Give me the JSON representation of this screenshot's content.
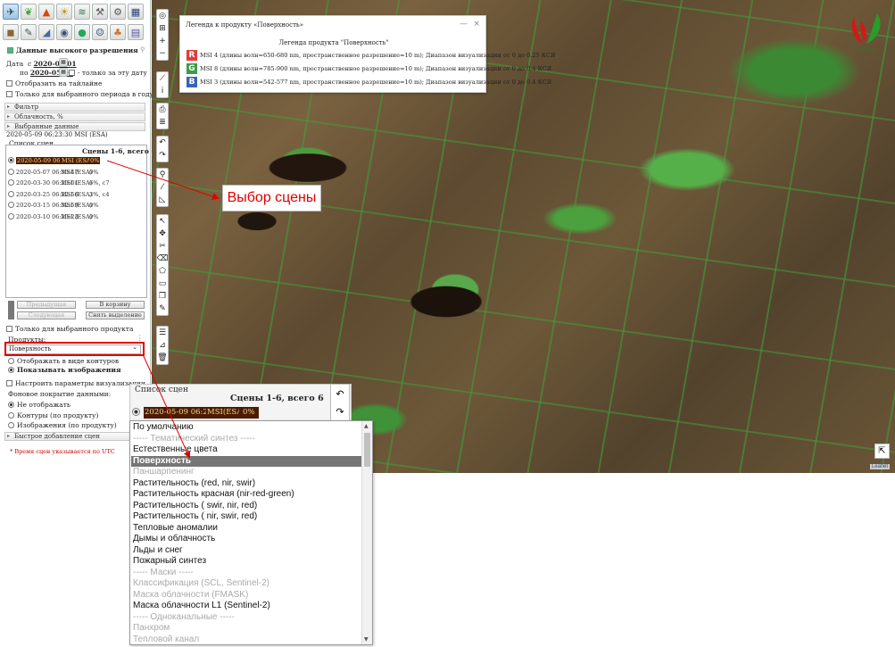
{
  "left": {
    "high_res_title": "Данные высокого разрешения",
    "date_label": "Дата",
    "from_label": "с",
    "date_from": "2020-03-01",
    "to_label": "по",
    "date_to": "2020-05-09",
    "only_date": "- только за эту дату",
    "show_tile": "Отобразить на тайлайне",
    "only_period": "Только для выбранного периода в году",
    "filter": "Фильтр",
    "cloud": "Облачность, %",
    "selected_data": "Выбранные данные",
    "selected_value": "2020-05-09 06:23:30 MSI (ESA)",
    "scene_list": "Список сцен",
    "scenes_header": "Сцены 1-6, всего 6",
    "scenes": [
      {
        "date": "2020-05-09 06:23:30",
        "src": "MSI (ESA)",
        "cloud": "0%"
      },
      {
        "date": "2020-05-07 06:33:47",
        "src": "MSI (ESA)",
        "cloud": "0%"
      },
      {
        "date": "2020-03-30 06:23:01",
        "src": "MSI (ESA)",
        "cloud": "6%, с7"
      },
      {
        "date": "2020-03-25 06:22:56",
        "src": "MSI (ESA)",
        "cloud": "3%, с4"
      },
      {
        "date": "2020-03-15 06:32:59",
        "src": "MSI (ESA)",
        "cloud": "0%"
      },
      {
        "date": "2020-03-10 06:23:23",
        "src": "MSI (ESA)",
        "cloud": "0%"
      }
    ],
    "prev": "Предыдущая",
    "to_basket": "В корзину",
    "next": "Следующая",
    "clear": "Снять выделение",
    "only_selected": "Только для выбранного продукта",
    "products": "Продукты:",
    "product_value": "Поверхность",
    "show_contours": "Отображать в виде контуров",
    "show_images": "Показывать изображения",
    "setup_vis": "Настроить параметры визуализации",
    "bg_coverage": "Фоновое покрытие данными:",
    "opt_none": "Не отображать",
    "opt_contours": "Контуры (по продукту)",
    "opt_images": "Изображения (по продукту)",
    "quick_add": "Быстрое добавление сцен",
    "utc_note": "* Время сцен указывается по UTC"
  },
  "legend": {
    "title": "Легенда к продукту «Поверхность»",
    "subtitle": "Легенда продукта \"Поверхность\"",
    "close": "×",
    "minimize": "—",
    "rows": [
      {
        "letter": "R",
        "color": "#e03c3c",
        "text": "MSI 4 (длины волн=650-680 nm, пространственное разрешение=10 m); Диапазон визуализации от 0 до 0.25 КСЯ"
      },
      {
        "letter": "G",
        "color": "#3c9a48",
        "text": "MSI 8 (длины волн=785-900 nm, пространственное разрешение=10 m); Диапазон визуализации от 0 до 0.4 КСЯ"
      },
      {
        "letter": "B",
        "color": "#3a63b8",
        "text": "MSI 3 (длины волн=542-577 nm, пространственное разрешение=10 m); Диапазон визуализации от 0 до 0.4 КСЯ"
      }
    ]
  },
  "annotation": "Выбор сцены",
  "map": {
    "attribution": "Leaflet",
    "logo": "VEGA-PRO"
  },
  "zoom": {
    "title": "Список сцен",
    "header": "Сцены 1-6, всего 6",
    "date": "2020-05-09 06:23:30",
    "src": "MSI(ESA)",
    "cloud": "0%"
  },
  "product_list": [
    {
      "label": "По умолчанию",
      "state": "normal"
    },
    {
      "label": "----- Тематический синтез -----",
      "state": "dim"
    },
    {
      "label": "Естественные цвета",
      "state": "normal"
    },
    {
      "label": "Поверхность",
      "state": "selected"
    },
    {
      "label": "Паншарпенинг",
      "state": "dim"
    },
    {
      "label": "Растительность (red, nir, swir)",
      "state": "normal"
    },
    {
      "label": "Растительность красная (nir-red-green)",
      "state": "normal"
    },
    {
      "label": "Растительность ( swir, nir, red)",
      "state": "normal"
    },
    {
      "label": "Растительность ( nir, swir, red)",
      "state": "normal"
    },
    {
      "label": "Тепловые аномалии",
      "state": "normal"
    },
    {
      "label": "Дымы и облачность",
      "state": "normal"
    },
    {
      "label": "Льды и снег",
      "state": "normal"
    },
    {
      "label": "Пожарный синтез",
      "state": "normal"
    },
    {
      "label": "----- Маски -----",
      "state": "dim"
    },
    {
      "label": "Классификация (SCL, Sentinel-2)",
      "state": "dim"
    },
    {
      "label": "Маска облачности (FMASK)",
      "state": "dim"
    },
    {
      "label": "Маска облачности L1 (Sentinel-2)",
      "state": "normal"
    },
    {
      "label": "----- Одноканальные -----",
      "state": "dim"
    },
    {
      "label": "Панхром",
      "state": "dim"
    },
    {
      "label": "Тепловой канал",
      "state": "dim"
    }
  ]
}
